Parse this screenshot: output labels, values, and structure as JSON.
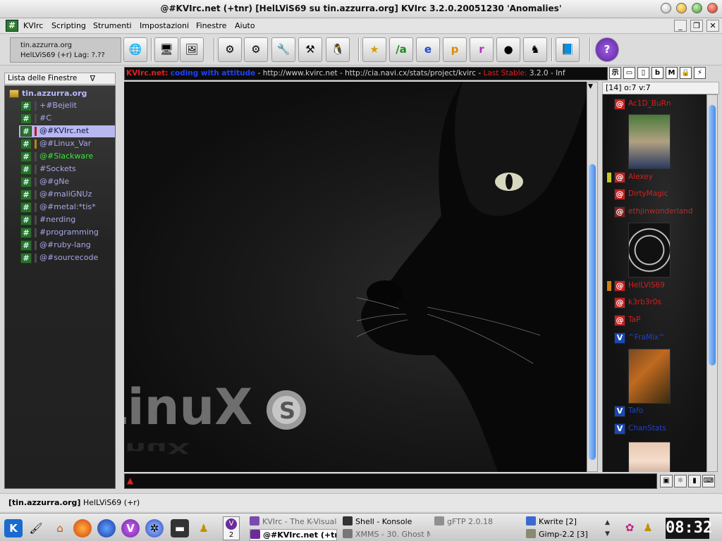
{
  "window": {
    "title": "@#KVIrc.net (+tnr) [HelLViS69 su tin.azzurra.org] KVIrc 3.2.0.20051230 'Anomalies'"
  },
  "menu": {
    "items": [
      "KVIrc",
      "Scripting",
      "Strumenti",
      "Impostazioni",
      "Finestre",
      "Aiuto"
    ]
  },
  "server_box": {
    "line1": "tin.azzurra.org",
    "line2": "HelLViS69 (+r) Lag: ?.??"
  },
  "window_list": {
    "header": "Lista delle Finestre",
    "root": "tin.azzurra.org",
    "channels": [
      {
        "label": "+#Bejelit",
        "color": "#a8a8e8",
        "act": "#4a4a4a"
      },
      {
        "label": "#C",
        "color": "#a8a8e8",
        "act": "#4a4a4a"
      },
      {
        "label": "@#KVIrc.net",
        "color": "#10104a",
        "act": "#c01818",
        "selected": true
      },
      {
        "label": "@#Linux_Var",
        "color": "#a8a8e8",
        "act": "#b8860b"
      },
      {
        "label": "@#Slackware",
        "color": "#38e838",
        "act": "#4a4a4a"
      },
      {
        "label": "#Sockets",
        "color": "#a8a8e8",
        "act": "#4a4a4a"
      },
      {
        "label": "@#gNe",
        "color": "#a8a8e8",
        "act": "#4a4a4a"
      },
      {
        "label": "@#maliGNUz",
        "color": "#a8a8e8",
        "act": "#4a4a4a"
      },
      {
        "label": "@#metal:*tis*",
        "color": "#a8a8e8",
        "act": "#4a4a4a"
      },
      {
        "label": "#nerding",
        "color": "#a8a8e8",
        "act": "#4a4a4a"
      },
      {
        "label": "#programming",
        "color": "#a8a8e8",
        "act": "#4a4a4a"
      },
      {
        "label": "@#ruby-lang",
        "color": "#a8a8e8",
        "act": "#4a4a4a"
      },
      {
        "label": "@#sourcecode",
        "color": "#a8a8e8",
        "act": "#4a4a4a"
      }
    ]
  },
  "topic": {
    "part1": "KVIrc.net:",
    "part2": "coding with attitude",
    "part3": "- http://www.kvirc.net - http://cia.navi.cx/stats/project/kvirc -",
    "part4": "Last Stable:",
    "part5": "3.2.0",
    "part6": "- Inf"
  },
  "topic_tools": [
    "示",
    "▭",
    "▯",
    "b",
    "M",
    "🔒",
    "⚡"
  ],
  "wallpaper": {
    "logo_text": "LinuX"
  },
  "userlist": {
    "header": "[14] o:7 v:7",
    "users": [
      {
        "nick": "Ac1D_BuRn",
        "mode": "@",
        "mode_bg": "#c42020",
        "color": "#d02020",
        "mark": ""
      },
      {
        "nick": "Alexey",
        "mode": "@",
        "mode_bg": "#c42020",
        "color": "#d02020",
        "mark": "#c8c820"
      },
      {
        "nick": "DirtyMagic",
        "mode": "@",
        "mode_bg": "#c42020",
        "color": "#d02020",
        "mark": ""
      },
      {
        "nick": "ethjinwonderland",
        "mode": "@",
        "mode_bg": "#7a2020",
        "color": "#b03030",
        "mark": ""
      },
      {
        "nick": "HelLViS69",
        "mode": "@",
        "mode_bg": "#c42020",
        "color": "#d02020",
        "mark": "#d08010"
      },
      {
        "nick": "k3rb3r0s",
        "mode": "@",
        "mode_bg": "#c42020",
        "color": "#d02020",
        "mark": ""
      },
      {
        "nick": "TaP",
        "mode": "@",
        "mode_bg": "#c42020",
        "color": "#d02020",
        "mark": ""
      },
      {
        "nick": "^FraMix^",
        "mode": "V",
        "mode_bg": "#1848b8",
        "color": "#2040c8",
        "mark": ""
      },
      {
        "nick": "Tafo",
        "mode": "V",
        "mode_bg": "#1848b8",
        "color": "#2040c8",
        "mark": ""
      },
      {
        "nick": "ChanStats",
        "mode": "V",
        "mode_bg": "#1848b8",
        "color": "#2040c8",
        "mark": ""
      }
    ]
  },
  "statusbar": {
    "text": "[tin.azzurra.org] HelLViS69 (+r)"
  },
  "taskbar": {
    "pager_num": "2",
    "tasks": [
      {
        "label": "KVIrc - The K-Visual",
        "state": "dim",
        "icon_color": "#7a4ab0"
      },
      {
        "label": "@#KVIrc.net (+tnr",
        "state": "active",
        "icon_color": "#6b2c9a"
      },
      {
        "label": "Shell - Konsole",
        "state": "normal",
        "icon_color": "#333333"
      },
      {
        "label": "XMMS - 30. Ghost M",
        "state": "dim",
        "icon_color": "#777777"
      },
      {
        "label": "gFTP 2.0.18",
        "state": "dim",
        "icon_color": "#909090"
      },
      {
        "label": "Kwrite [2]",
        "state": "normal",
        "icon_color": "#3a6ad0"
      },
      {
        "label": "Gimp-2.2 [3]",
        "state": "normal",
        "icon_color": "#8a8a70"
      }
    ],
    "clock": "08:32"
  }
}
